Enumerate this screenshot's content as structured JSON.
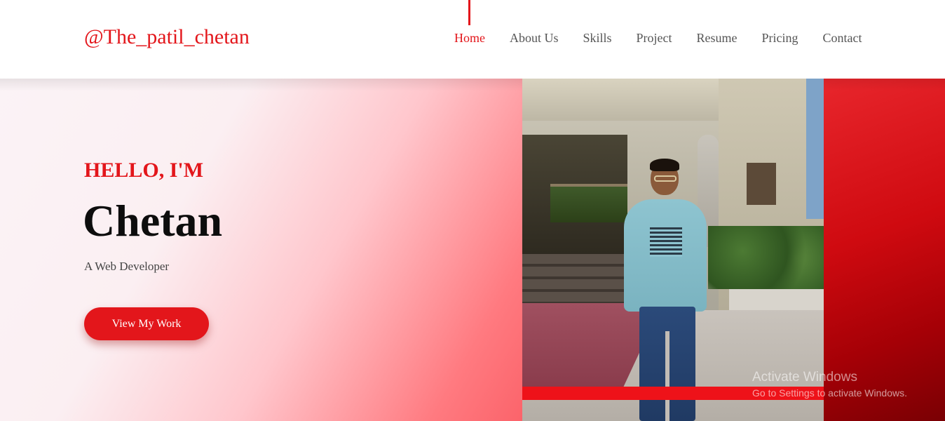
{
  "brand": "@The_patil_chetan",
  "nav": {
    "items": [
      "Home",
      "About Us",
      "Skills",
      "Project",
      "Resume",
      "Pricing",
      "Contact"
    ],
    "active": "Home"
  },
  "hero": {
    "greeting": "HELLO, I'M",
    "name": "Chetan",
    "role": "A Web Developer",
    "cta_label": "View My Work"
  },
  "watermark": {
    "title": "Activate Windows",
    "subtitle": "Go to Settings to activate Windows."
  },
  "colors": {
    "accent": "#e3161b",
    "heading": "#0d0d0d",
    "nav_text": "#555555"
  }
}
